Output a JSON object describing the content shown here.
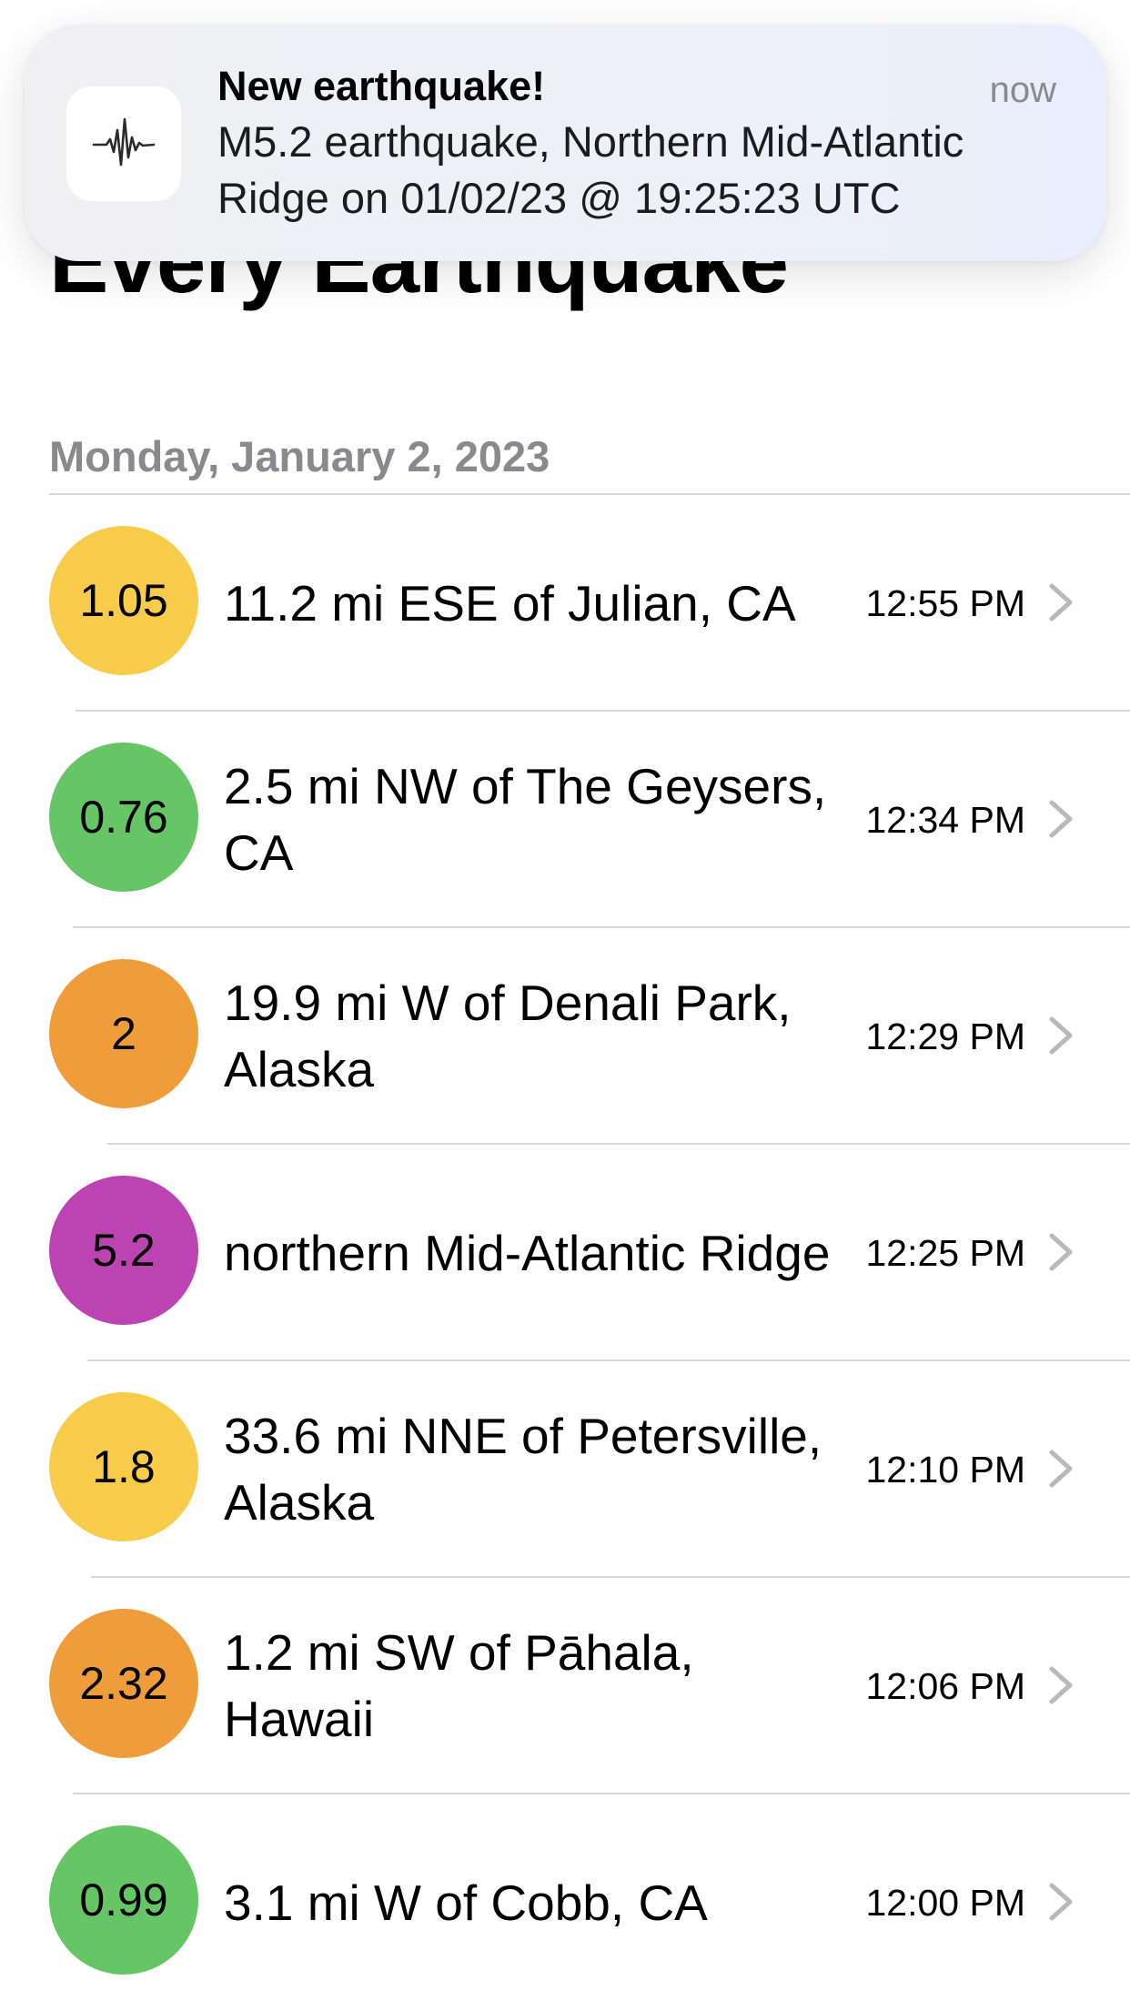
{
  "header": {
    "title": "Every Earthquake"
  },
  "section": {
    "date": "Monday, January 2, 2023"
  },
  "notification": {
    "title": "New earthquake!",
    "time": "now",
    "body": "M5.2 earthquake, Northern Mid-Atlantic Ridge on 01/02/23 @ 19:25:23 UTC",
    "icon": "seismograph-icon"
  },
  "colors": {
    "yellow": "#f8cc4a",
    "green": "#66c565",
    "orange": "#ef9c3a",
    "purple": "#bb44b2"
  },
  "quakes": [
    {
      "magnitude": "1.05",
      "place": "11.2 mi ESE of Julian, CA",
      "time": "12:55 PM",
      "color": "#f8cc4a"
    },
    {
      "magnitude": "0.76",
      "place": "2.5 mi NW of The Geysers, CA",
      "time": "12:34 PM",
      "color": "#66c565"
    },
    {
      "magnitude": "2",
      "place": "19.9 mi W of Denali Park, Alaska",
      "time": "12:29 PM",
      "color": "#ef9c3a"
    },
    {
      "magnitude": "5.2",
      "place": "northern Mid-Atlantic Ridge",
      "time": "12:25 PM",
      "color": "#bb44b2"
    },
    {
      "magnitude": "1.8",
      "place": "33.6 mi NNE of Petersville, Alaska",
      "time": "12:10 PM",
      "color": "#f8cc4a"
    },
    {
      "magnitude": "2.32",
      "place": "1.2 mi SW of Pāhala, Hawaii",
      "time": "12:06 PM",
      "color": "#ef9c3a"
    },
    {
      "magnitude": "0.99",
      "place": "3.1 mi W of Cobb, CA",
      "time": "12:00 PM",
      "color": "#66c565"
    }
  ]
}
